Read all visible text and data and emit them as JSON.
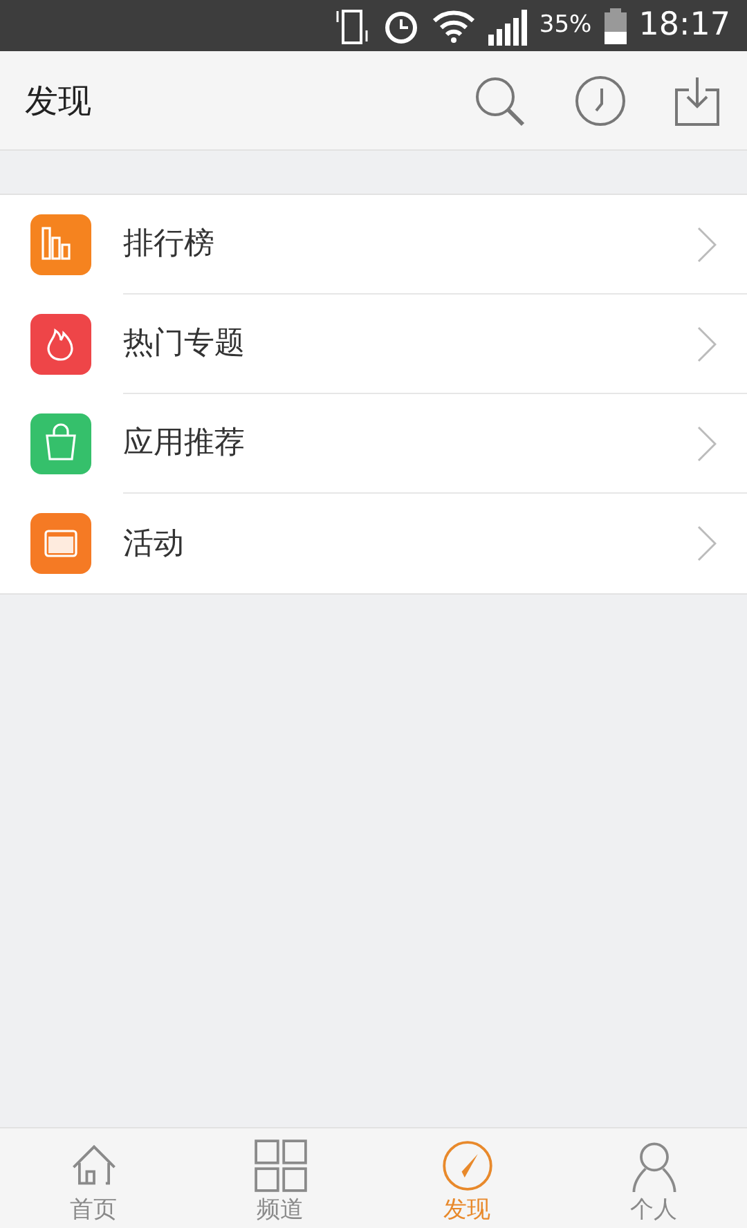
{
  "status_bar": {
    "battery": "35%",
    "time": "18:17"
  },
  "header": {
    "title": "发现"
  },
  "menu": [
    {
      "kind": "chart",
      "label": "排行榜",
      "color": "#f5831f"
    },
    {
      "kind": "fire",
      "label": "热门专题",
      "color": "#ee4548"
    },
    {
      "kind": "bag",
      "label": "应用推荐",
      "color": "#35c06b"
    },
    {
      "kind": "calendar",
      "label": "活动",
      "color": "#f57a24"
    }
  ],
  "tabs": [
    {
      "kind": "home",
      "label": "首页",
      "selected": false
    },
    {
      "kind": "grid",
      "label": "频道",
      "selected": false
    },
    {
      "kind": "compass",
      "label": "发现",
      "selected": true
    },
    {
      "kind": "person",
      "label": "个人",
      "selected": false
    }
  ]
}
